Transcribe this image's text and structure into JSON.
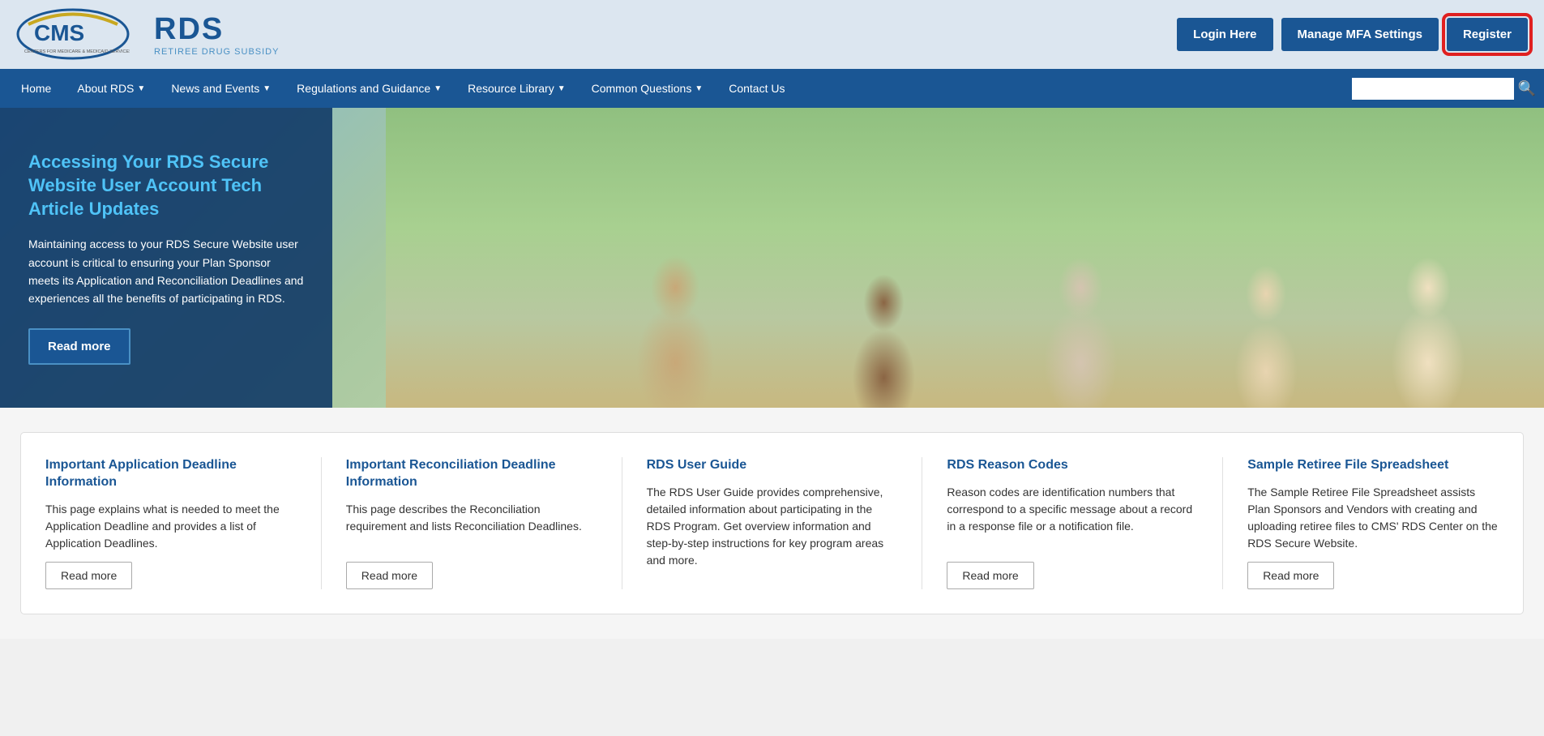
{
  "header": {
    "cms_logo_text": "CMS",
    "cms_subtitle": "CENTERS FOR MEDICARE & MEDICAID SERVICES",
    "rds_text": "RDS",
    "rds_subtitle": "RETIREE DRUG SUBSIDY",
    "buttons": {
      "login": "Login Here",
      "mfa": "Manage MFA Settings",
      "register": "Register"
    }
  },
  "nav": {
    "items": [
      {
        "label": "Home",
        "has_dropdown": false
      },
      {
        "label": "About RDS",
        "has_dropdown": true
      },
      {
        "label": "News and Events",
        "has_dropdown": true
      },
      {
        "label": "Regulations and Guidance",
        "has_dropdown": true
      },
      {
        "label": "Resource Library",
        "has_dropdown": true
      },
      {
        "label": "Common Questions",
        "has_dropdown": true
      },
      {
        "label": "Contact Us",
        "has_dropdown": false
      }
    ],
    "search_placeholder": ""
  },
  "hero": {
    "title": "Accessing Your RDS Secure Website User Account Tech Article Updates",
    "description": "Maintaining access to your RDS Secure Website user account is critical to ensuring your Plan Sponsor meets its Application and Reconciliation Deadlines and experiences all the benefits of participating in RDS.",
    "read_more": "Read more"
  },
  "cards": [
    {
      "title": "Important Application Deadline Information",
      "description": "This page explains what is needed to meet the Application Deadline and provides a list of Application Deadlines.",
      "read_more": "Read more"
    },
    {
      "title": "Important Reconciliation Deadline Information",
      "description": "This page describes the Reconciliation requirement and lists Reconciliation Deadlines.",
      "read_more": "Read more"
    },
    {
      "title": "RDS User Guide",
      "description": "The RDS User Guide provides comprehensive, detailed information about participating in the RDS Program. Get overview information and step-by-step instructions for key program areas and more.",
      "read_more": null
    },
    {
      "title": "RDS Reason Codes",
      "description": "Reason codes are identification numbers that correspond to a specific message about a record in a response file or a notification file.",
      "read_more": "Read more"
    },
    {
      "title": "Sample Retiree File Spreadsheet",
      "description": "The Sample Retiree File Spreadsheet assists Plan Sponsors and Vendors with creating and uploading retiree files to CMS' RDS Center on the RDS Secure Website.",
      "read_more": "Read more"
    }
  ]
}
